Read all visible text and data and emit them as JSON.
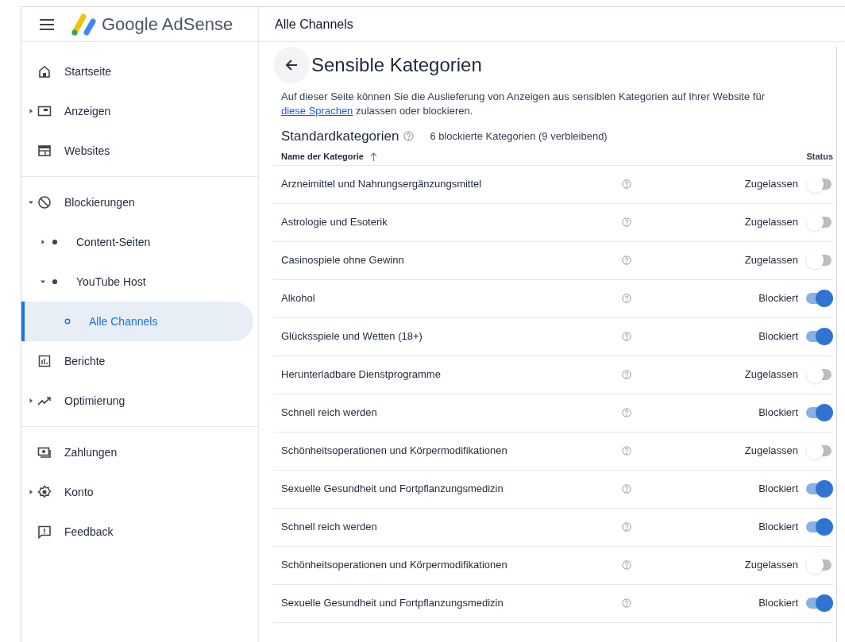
{
  "header": {
    "product": "Google AdSense",
    "page_title": "Alle Channels"
  },
  "sidebar": {
    "sections": [
      [
        {
          "label": "Startseite",
          "kind": "home",
          "selected": false
        },
        {
          "label": "Anzeigen",
          "kind": "ads",
          "expanded": false,
          "selected": false
        },
        {
          "label": "Websites",
          "kind": "sites",
          "selected": false
        }
      ],
      [
        {
          "label": "Blockierungen",
          "kind": "block",
          "expanded": true,
          "selected": false,
          "children": [
            {
              "label": "Content-Seiten",
              "kind": "dot",
              "expanded": false,
              "selected": false
            },
            {
              "label": "YouTube Host",
              "kind": "dot",
              "expanded": true,
              "selected": false,
              "children": [
                {
                  "label": "Alle Channels",
                  "kind": "ring",
                  "selected": true
                }
              ]
            }
          ]
        },
        {
          "label": "Berichte",
          "kind": "reports",
          "selected": false
        },
        {
          "label": "Optimierung",
          "kind": "trend",
          "expanded": false,
          "selected": false
        }
      ],
      [
        {
          "label": "Zahlungen",
          "kind": "payments",
          "selected": false
        },
        {
          "label": "Konto",
          "kind": "gear",
          "expanded": false,
          "selected": false
        },
        {
          "label": "Feedback",
          "kind": "feedback",
          "selected": false
        }
      ]
    ]
  },
  "main": {
    "title": "Sensible Kategorien",
    "description": "Auf dieser Seite können Sie die Auslieferung von Anzeigen aus sensiblen Kategorien auf Ihrer Website für ",
    "link": "diese Sprachen",
    "description_end": " zulassen oder blockieren.",
    "section_title": "Standardkategorien",
    "summary": "6 blockierte Kategorien (9 verbleibend)",
    "table": {
      "columns": [
        "Name der Kategorie",
        "Status"
      ],
      "rows": [
        {
          "name": "Arzneimittel und Nahrungsergänzungsmittel",
          "status": "Zugelassen",
          "on": false
        },
        {
          "name": "Astrologie und Esoterik",
          "status": "Zugelassen",
          "on": false
        },
        {
          "name": "Casinospiele ohne Gewinn",
          "status": "Zugelassen",
          "on": false
        },
        {
          "name": "Alkohol",
          "status": "Blockiert",
          "on": true
        },
        {
          "name": "Glücksspiele und Wetten (18+)",
          "status": "Blockiert",
          "on": true
        },
        {
          "name": "Herunterladbare Dienstprogramme",
          "status": "Zugelassen",
          "on": false
        },
        {
          "name": "Schnell reich werden",
          "status": "Blockiert",
          "on": true
        },
        {
          "name": "Schönheitsoperationen und Körpermodifikationen",
          "status": "Zugelassen",
          "on": false
        },
        {
          "name": "Sexuelle Gesundheit und Fortpflanzungsmedizin",
          "status": "Blockiert",
          "on": true
        },
        {
          "name": "Schnell reich werden",
          "status": "Blockiert",
          "on": true
        },
        {
          "name": "Schönheitsoperationen und Körpermodifikationen",
          "status": "Zugelassen",
          "on": false
        },
        {
          "name": "Sexuelle Gesundheit und Fortpflanzungsmedizin",
          "status": "Blockiert",
          "on": true
        }
      ]
    }
  }
}
